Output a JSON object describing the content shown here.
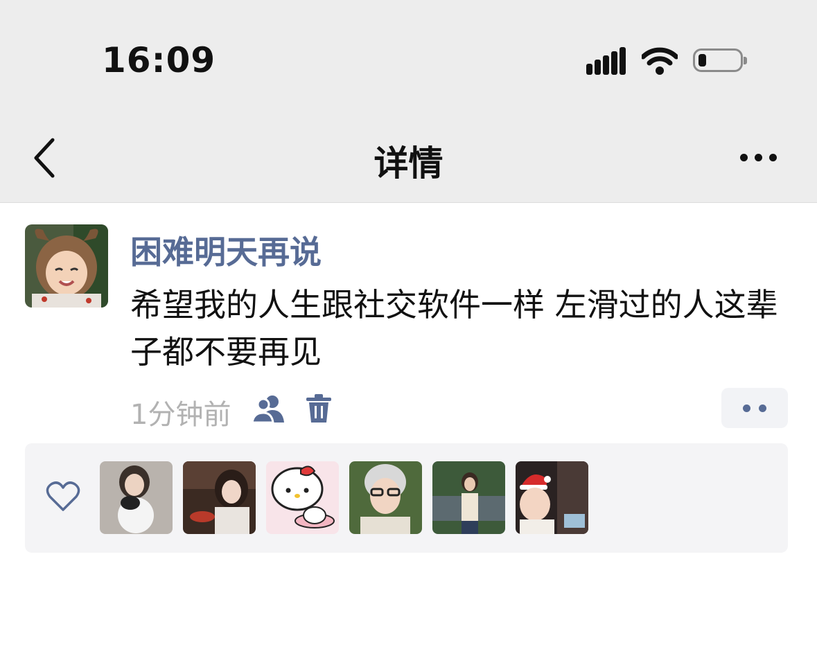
{
  "status_bar": {
    "time": "16:09",
    "signal_icon": "signal-bars-icon",
    "wifi_icon": "wifi-icon",
    "battery_icon": "battery-low-icon",
    "battery_level": 0.15
  },
  "nav": {
    "back_icon": "chevron-left-icon",
    "title": "详情",
    "more_icon": "ellipsis-icon"
  },
  "post": {
    "author": "困难明天再说",
    "content": "希望我的人生跟社交软件一样 左滑过的人这辈子都不要再见",
    "time_ago": "1分钟前",
    "visibility_icon": "people-icon",
    "delete_icon": "trash-icon",
    "action_icon": "two-dots-icon"
  },
  "likes": {
    "heart_icon": "heart-outline-icon",
    "count_shown": 6
  },
  "colors": {
    "link_blue": "#576b95",
    "header_bg": "#ededed",
    "meta_grey": "#b2b2b2",
    "likes_bg": "#f4f4f6"
  }
}
